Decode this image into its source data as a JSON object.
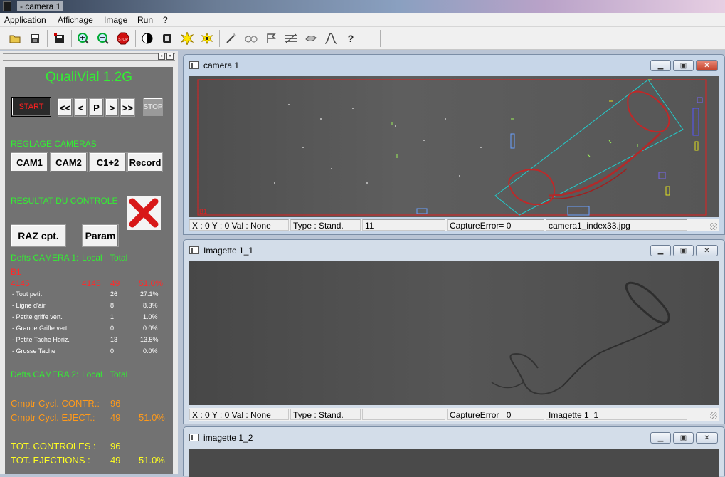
{
  "window": {
    "title": "- camera 1"
  },
  "menu": [
    "Application",
    "Affichage",
    "Image",
    "Run",
    "?"
  ],
  "toolbar": {
    "icons": [
      "open-folder-icon",
      "save-icon",
      "save-as-icon",
      "zoom-in-icon",
      "zoom-out-icon",
      "stop-sign-icon",
      "contrast-icon",
      "square-icon",
      "burst-yellow-icon",
      "burst-small-icon",
      "magic-wand-icon",
      "glasses-icon",
      "flag-icon",
      "lines-icon",
      "hand-icon",
      "curve-icon",
      "help-icon"
    ]
  },
  "panel": {
    "app_name": "QualiVial 1.2G",
    "start_label": "START",
    "nav": [
      "<<",
      "<",
      "P",
      ">",
      ">>"
    ],
    "stop_label": "STOP",
    "reglage_title": "REGLAGE CAMERAS",
    "cam_buttons": [
      "CAM1",
      "CAM2",
      "C1+2",
      "Record"
    ],
    "resultat_title": "RESULTAT DU CONTROLE",
    "raz_label": "RAZ cpt.",
    "param_label": "Param",
    "cam1_header": {
      "label": "Defts CAMERA 1:",
      "local": "Local",
      "total": "Total"
    },
    "b1": "B1",
    "b1_row": {
      "a": "4145",
      "b": "4145",
      "c": "49",
      "d": "51.0%"
    },
    "defects": [
      {
        "name": "- Tout petit",
        "count": "26",
        "pct": "27.1%"
      },
      {
        "name": "- Ligne d'air",
        "count": "8",
        "pct": "8.3%"
      },
      {
        "name": "- Petite griffe vert.",
        "count": "1",
        "pct": "1.0%"
      },
      {
        "name": "- Grande Griffe vert.",
        "count": "0",
        "pct": "0.0%"
      },
      {
        "name": "- Petite Tache Horiz.",
        "count": "13",
        "pct": "13.5%"
      },
      {
        "name": "- Grosse Tache",
        "count": "0",
        "pct": "0.0%"
      }
    ],
    "cam2_header": {
      "label": "Defts CAMERA 2:",
      "local": "Local",
      "total": "Total"
    },
    "cmptr_contr": {
      "label": "Cmptr Cycl. CONTR.:",
      "value": "96"
    },
    "cmptr_eject": {
      "label": "Cmptr Cycl. EJECT.:",
      "value": "49",
      "pct": "51.0%"
    },
    "tot_controles": {
      "label": "TOT. CONTROLES :",
      "value": "96"
    },
    "tot_ejections": {
      "label": "TOT. EJECTIONS :",
      "value": "49",
      "pct": "51.0%"
    }
  },
  "windows": [
    {
      "title": "camera 1",
      "region_label": "B1",
      "status": [
        "X : 0 Y : 0 Val : None",
        "Type : Stand.",
        "11",
        "CaptureError= 0",
        "camera1_index33.jpg"
      ]
    },
    {
      "title": "Imagette 1_1",
      "status": [
        "X : 0 Y : 0 Val : None",
        "Type : Stand.",
        "",
        "CaptureError= 0",
        "Imagette 1_1"
      ]
    },
    {
      "title": "imagette 1_2"
    }
  ],
  "colors": {
    "green_text": "#33ee33",
    "red_text": "#ff2a2a",
    "orange_text": "#ff9a1a",
    "yellow_text": "#ffff22",
    "roi_red": "#e02020",
    "roi_cyan": "#22cccc"
  }
}
